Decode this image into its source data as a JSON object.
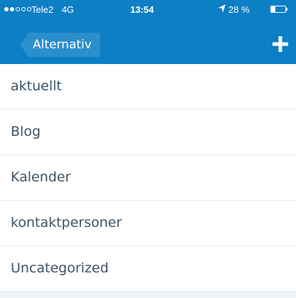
{
  "status_bar": {
    "signal_dots": [
      true,
      true,
      false,
      false,
      false
    ],
    "carrier": "Tele2",
    "network": "4G",
    "time": "13:54",
    "location_icon": "location-arrow-icon",
    "battery_percent_text": "28 %",
    "battery_level": 0.28
  },
  "nav_bar": {
    "back_label": "Alternativ",
    "add_icon": "plus-icon"
  },
  "categories": [
    {
      "label": "aktuellt"
    },
    {
      "label": "Blog"
    },
    {
      "label": "Kalender"
    },
    {
      "label": "kontaktpersoner"
    },
    {
      "label": "Uncategorized"
    }
  ],
  "colors": {
    "header": "#0c7fc5",
    "back_button": "#2b8fcd",
    "item_text": "#3e5466",
    "background": "#f1f4f7"
  }
}
